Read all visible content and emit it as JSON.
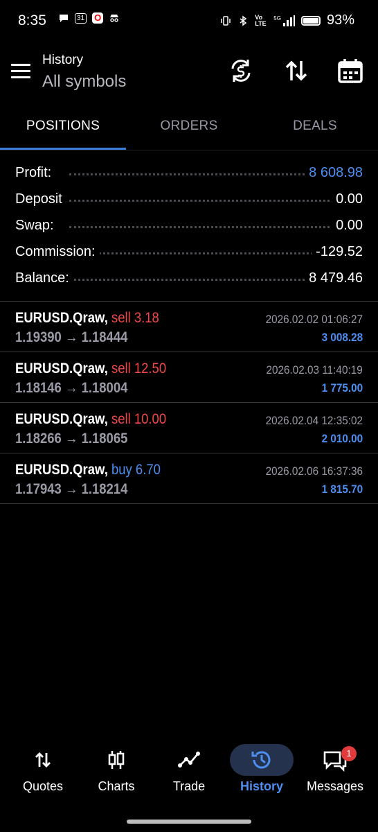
{
  "status_bar": {
    "time": "8:35",
    "calendar_day": "31",
    "opera_letter": "O",
    "volte_label": "Vo LTE",
    "network": "5G",
    "battery_percent": "93%"
  },
  "app_bar": {
    "title": "History",
    "subtitle": "All symbols"
  },
  "tabs": [
    {
      "label": "POSITIONS",
      "active": true
    },
    {
      "label": "ORDERS",
      "active": false
    },
    {
      "label": "DEALS",
      "active": false
    }
  ],
  "summary": {
    "profit": {
      "label": "Profit:",
      "value": "8 608.98"
    },
    "deposit": {
      "label": "Deposit",
      "value": "0.00"
    },
    "swap": {
      "label": "Swap:",
      "value": "0.00"
    },
    "commission": {
      "label": "Commission:",
      "value": "-129.52"
    },
    "balance": {
      "label": "Balance:",
      "value": "8 479.46"
    }
  },
  "deals": [
    {
      "symbol": "EURUSD.Qraw,",
      "side": "sell 3.18",
      "open": "1.19390",
      "arrow": "→",
      "close": "1.18444",
      "time": "2026.02.02 01:06:27",
      "profit": "3 008.28"
    },
    {
      "symbol": "EURUSD.Qraw,",
      "side": "sell 12.50",
      "open": "1.18146",
      "arrow": "→",
      "close": "1.18004",
      "time": "2026.02.03 11:40:19",
      "profit": "1 775.00"
    },
    {
      "symbol": "EURUSD.Qraw,",
      "side": "sell 10.00",
      "open": "1.18266",
      "arrow": "→",
      "close": "1.18065",
      "time": "2026.02.04 12:35:02",
      "profit": "2 010.00"
    },
    {
      "symbol": "EURUSD.Qraw,",
      "side": "buy 6.70",
      "open": "1.17943",
      "arrow": "→",
      "close": "1.18214",
      "time": "2026.02.06 16:37:36",
      "profit": "1 815.70"
    }
  ],
  "bottom_nav": {
    "quotes": "Quotes",
    "charts": "Charts",
    "trade": "Trade",
    "history": "History",
    "messages": "Messages",
    "messages_badge": "1"
  },
  "colors": {
    "accent_blue": "#4d8ef0",
    "sell_red": "#ef4848",
    "background": "#000000"
  }
}
